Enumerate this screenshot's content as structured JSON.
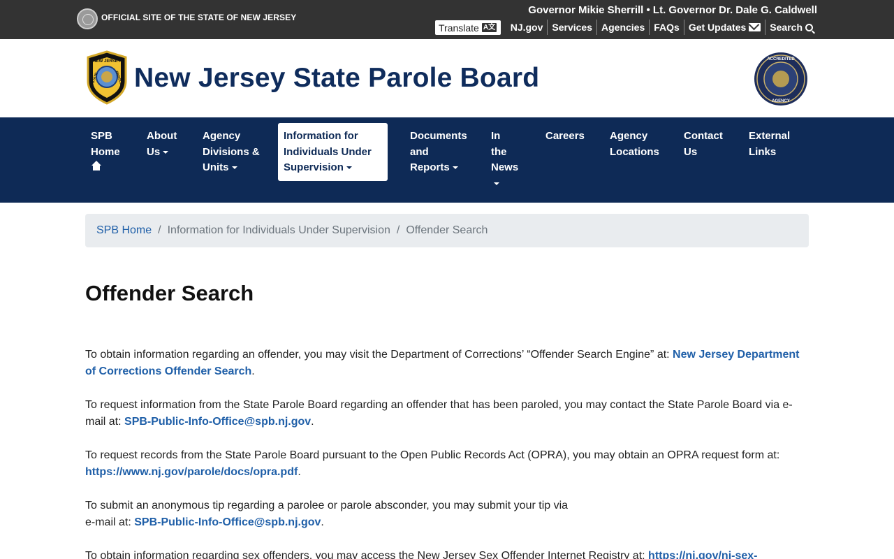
{
  "statebar": {
    "official": "OFFICIAL SITE OF THE STATE OF NEW JERSEY",
    "governor": "Governor Mikie Sherrill • Lt. Governor Dr. Dale G. Caldwell",
    "translate": "Translate",
    "translate_icon": "A文",
    "links": [
      "NJ.gov",
      "Services",
      "Agencies",
      "FAQs",
      "Get Updates",
      "Search"
    ]
  },
  "header": {
    "title": "New Jersey State Parole Board",
    "badge_text": [
      "NEW JERSEY",
      "STATE",
      "PAROLE"
    ],
    "accredited_text": [
      "ACCREDITED",
      "AGENCY"
    ]
  },
  "nav": {
    "items": [
      {
        "lines": [
          "SPB",
          "Home"
        ]
      },
      {
        "lines": [
          "About",
          "Us"
        ]
      },
      {
        "lines": [
          "Agency",
          "Divisions &",
          "Units"
        ]
      },
      {
        "lines": [
          "Information for",
          "Individuals Under",
          "Supervision"
        ]
      },
      {
        "lines": [
          "Documents",
          "and",
          "Reports"
        ]
      },
      {
        "lines": [
          "In",
          "the",
          "News"
        ]
      },
      {
        "lines": [
          "Careers"
        ]
      },
      {
        "lines": [
          "Agency",
          "Locations"
        ]
      },
      {
        "lines": [
          "Contact",
          "Us"
        ]
      },
      {
        "lines": [
          "External",
          "Links"
        ]
      }
    ]
  },
  "breadcrumb": {
    "home": "SPB Home",
    "parent": "Information for Individuals Under Supervision",
    "current": "Offender Search",
    "separator": "/"
  },
  "page": {
    "title": "Offender Search",
    "p1_text": "To obtain information regarding an offender, you may visit the Department of Corrections’ “Offender Search Engine” at: ",
    "p1_link": "New Jersey Department of Corrections Offender Search",
    "p2_text": "To request information from the State Parole Board regarding an offender that has been paroled, you may contact the State Parole Board via e-mail at: ",
    "p2_link": "SPB-Public-Info-Office@spb.nj.gov",
    "p3_text": "To request records from the State Parole Board pursuant to the Open Public Records Act (OPRA), you may obtain an OPRA request form at: ",
    "p3_link": "https://www.nj.gov/parole/docs/opra.pdf",
    "p4_text_a": "To submit an anonymous tip regarding a parolee or parole absconder, you may submit your tip via",
    "p4_text_b": "e-mail at: ",
    "p4_link": "SPB-Public-Info-Office@spb.nj.gov",
    "p5_text": "To obtain information regarding sex offenders, you may access the New Jersey Sex Offender Internet Registry at: ",
    "p5_link": "https://nj.gov/ni-sex-"
  },
  "colors": {
    "statebar": "#333333",
    "nav": "#0e2a56",
    "title": "#0f2c5c",
    "link": "#1f5fa8"
  }
}
